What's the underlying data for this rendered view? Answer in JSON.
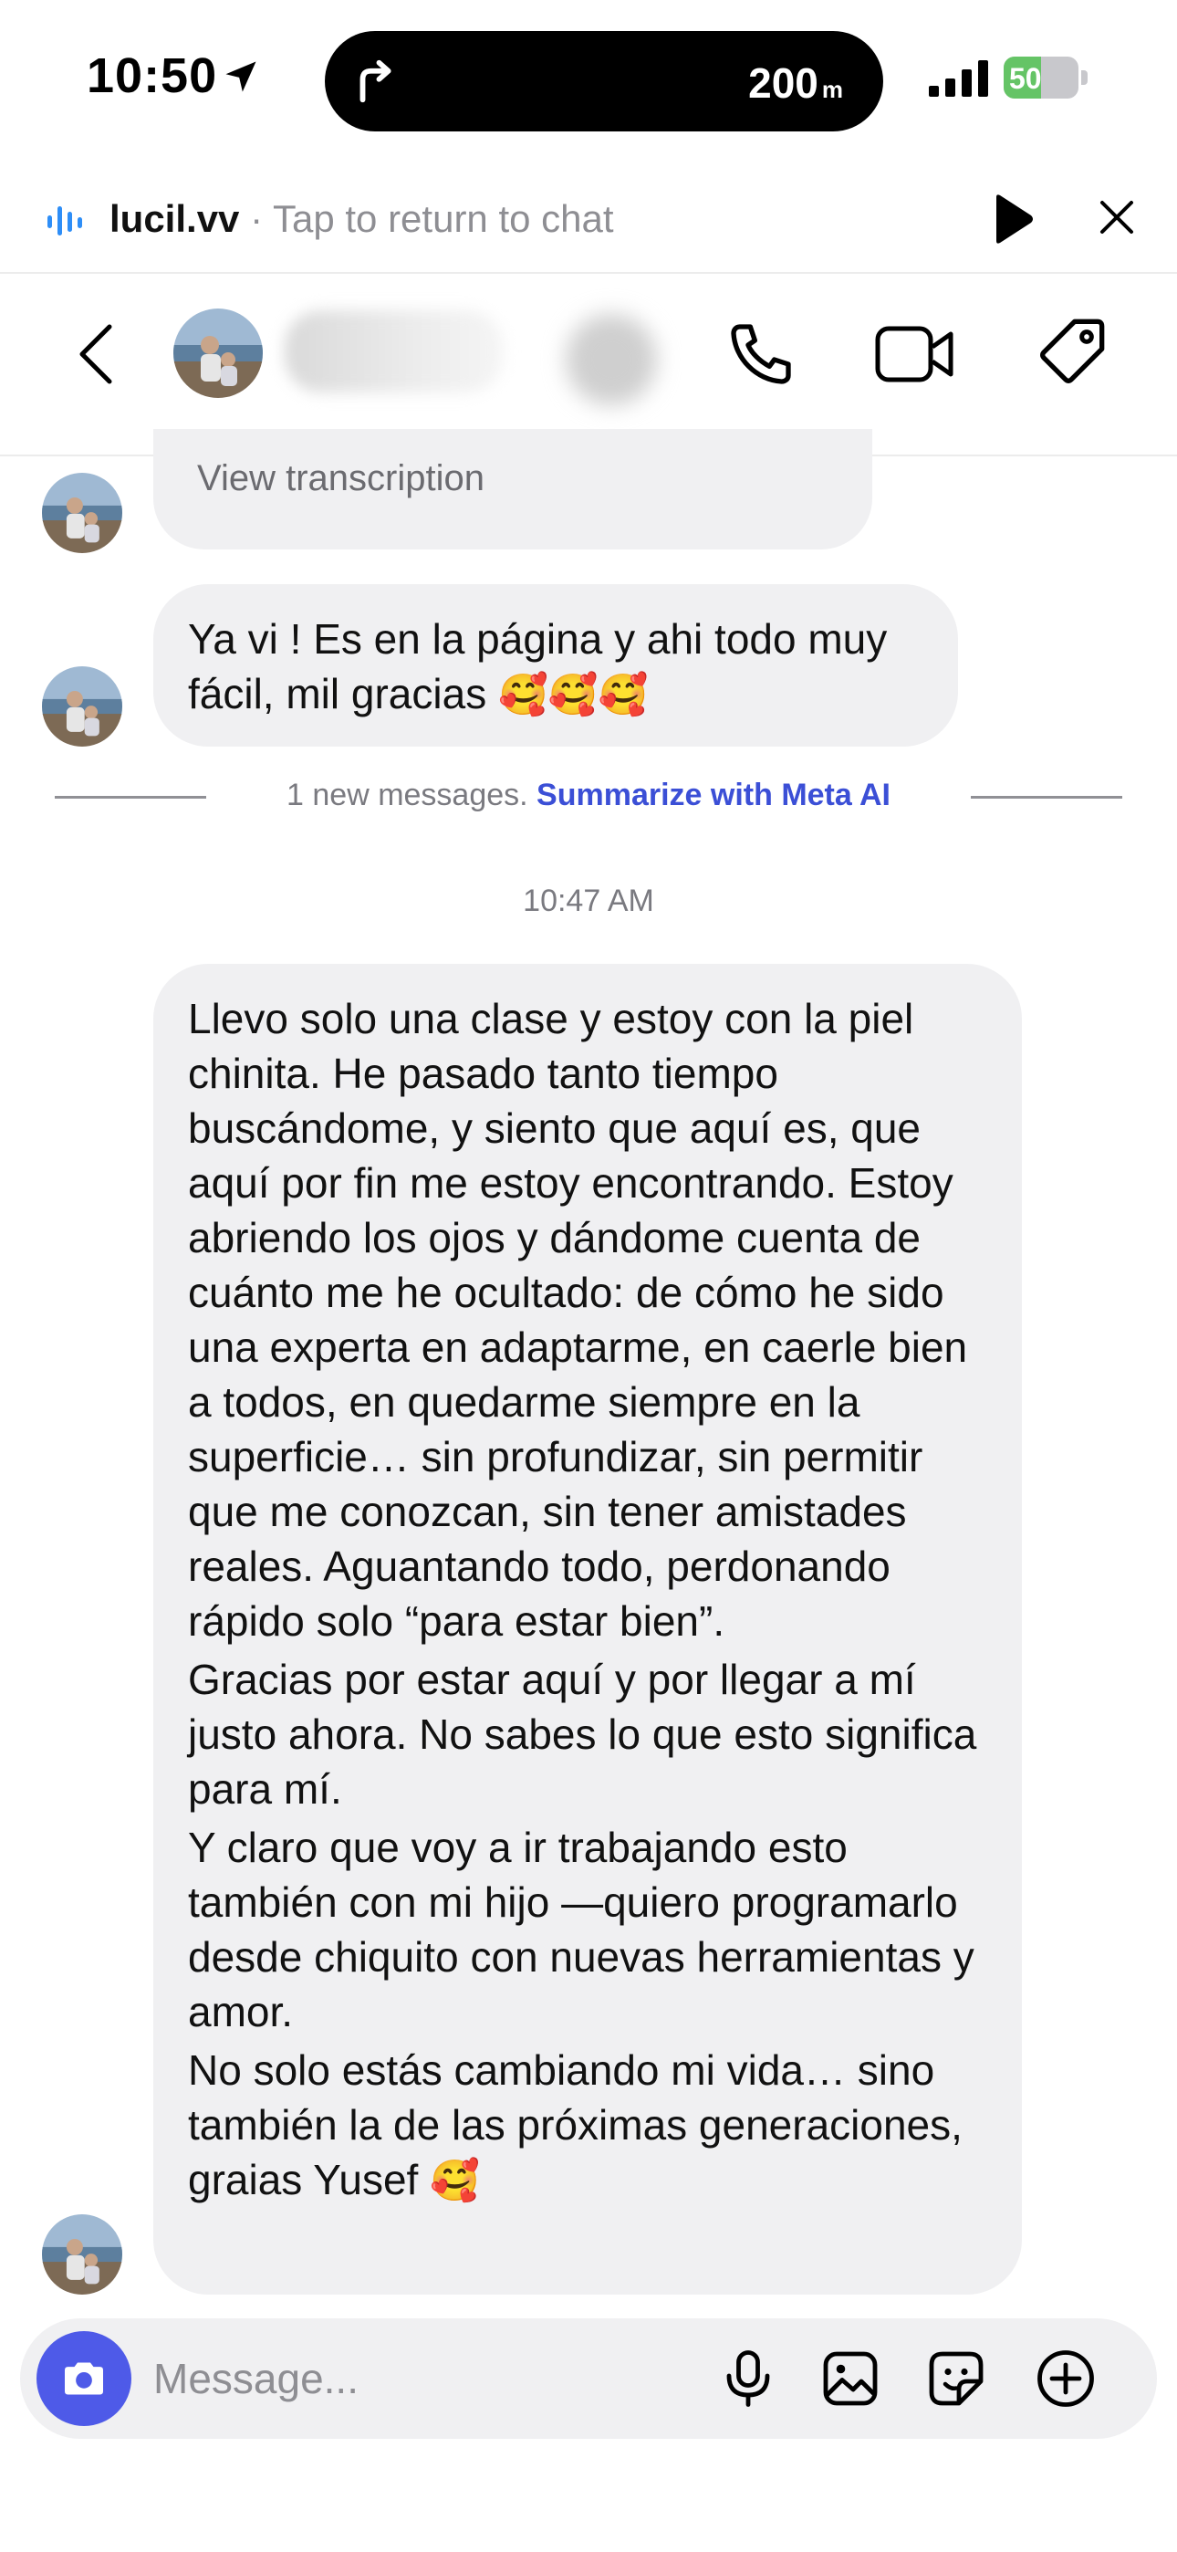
{
  "status_bar": {
    "time": "10:50",
    "navigation_distance": "200",
    "navigation_unit": "m",
    "battery_percent": "50",
    "battery_level": 0.5,
    "battery_color": "#65c466"
  },
  "call_banner": {
    "username": "lucil.vv",
    "separator": " · ",
    "message": "Tap to return to chat"
  },
  "header": {
    "contact_icon": "avatar-photo"
  },
  "messages": {
    "transcription_label": "View transcription",
    "msg1": "Ya vi ! Es en la página y ahi todo muy fácil, mil gracias",
    "msg1_emoji": "🥰🥰🥰",
    "new_messages_text": "1 new messages. ",
    "summarize_link": "Summarize with Meta AI",
    "timestamp": "10:47 AM",
    "msg2_p1": "Llevo solo una clase y estoy con la piel chinita. He pasado tanto tiempo buscándome, y siento que aquí es, que aquí por fin me estoy encontrando. Estoy abriendo los ojos y dándome cuenta de cuánto me he ocultado: de cómo he sido una experta en adaptarme, en caerle bien a todos, en quedarme siempre en la superficie… sin profundizar, sin permitir que me conozcan, sin tener amistades reales. Aguantando todo, perdonando rápido solo “para estar bien”.",
    "msg2_p2": "Gracias por estar aquí y por llegar a mí justo ahora. No sabes lo que esto significa para mí.",
    "msg2_p3": "Y claro que voy a ir trabajando esto también con mi hijo —quiero programarlo desde chiquito con nuevas herramientas y amor.",
    "msg2_p4": "No solo estás cambiando mi vida… sino también la de las próximas generaciones, graias Yusef",
    "msg2_emoji": "🥰"
  },
  "composer": {
    "placeholder": "Message..."
  },
  "colors": {
    "accent": "#4e5ae8",
    "link": "#3b4fd6",
    "bubble": "#f0f0f2"
  }
}
